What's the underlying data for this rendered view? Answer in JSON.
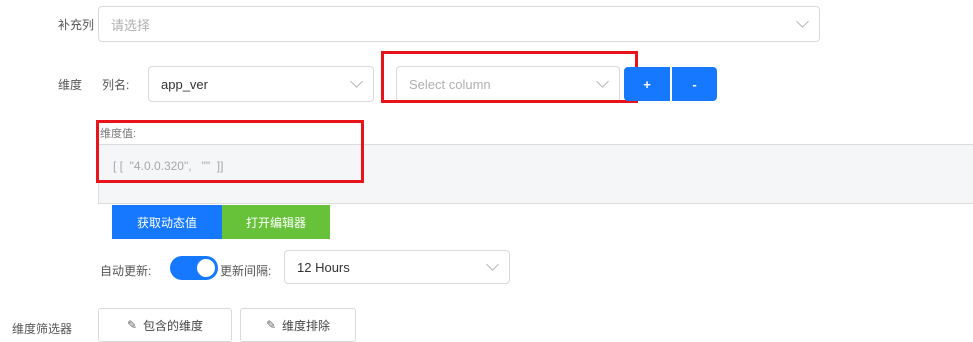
{
  "supplement_row": {
    "label": "补充列",
    "placeholder": "请选择"
  },
  "dimension_row": {
    "label": "维度",
    "column_name_label": "列名:",
    "column_value": "app_ver",
    "select_column_placeholder": "Select column",
    "add_label": "+",
    "remove_label": "-"
  },
  "dimension_values": {
    "label": "维度值:",
    "value": "[ [  \"4.0.0.320\",   \"\"  ]]"
  },
  "actions": {
    "fetch_dynamic_label": "获取动态值",
    "open_editor_label": "打开编辑器"
  },
  "auto_refresh": {
    "label": "自动更新:",
    "enabled": true,
    "interval_label": "更新间隔:",
    "interval_value": "12 Hours"
  },
  "dimension_filter": {
    "label": "维度筛选器",
    "include_label": "包含的维度",
    "exclude_label": "维度排除"
  },
  "colors": {
    "primary": "#1677ff",
    "success": "#67c23a",
    "highlight": "#e8141c"
  },
  "icons": {
    "select_arrow": "chevron-down-icon",
    "edit": "pencil-icon"
  }
}
